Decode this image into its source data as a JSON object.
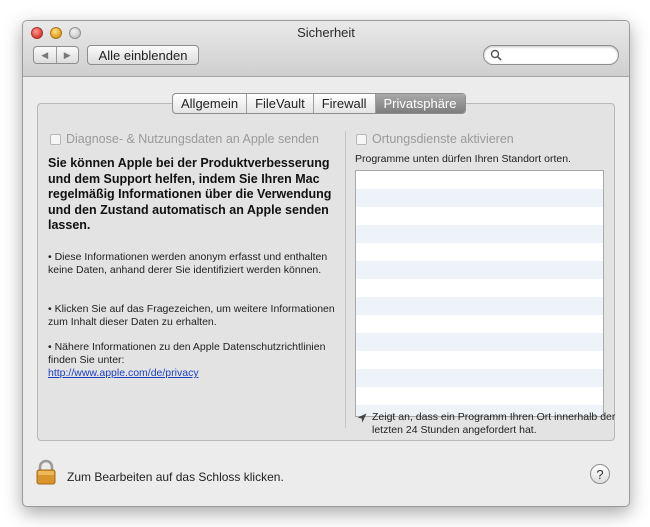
{
  "window": {
    "title": "Sicherheit"
  },
  "toolbar": {
    "back_glyph": "◀",
    "forward_glyph": "▶",
    "show_all_label": "Alle einblenden",
    "search_placeholder": "",
    "search_value": ""
  },
  "tabs": [
    {
      "label": "Allgemein",
      "active": false
    },
    {
      "label": "FileVault",
      "active": false
    },
    {
      "label": "Firewall",
      "active": false
    },
    {
      "label": "Privatsphäre",
      "active": true
    }
  ],
  "privacy": {
    "diagnostics_checkbox": {
      "label": "Diagnose- & Nutzungsdaten an Apple senden",
      "checked": false,
      "enabled": false
    },
    "intro_bold": "Sie können Apple bei der Produktverbesserung und dem Support helfen, indem Sie Ihren Mac regelmäßig Informationen über die Verwendung und den Zustand automatisch an Apple senden lassen.",
    "bullet_1": "• Diese Informationen werden anonym erfasst und enthalten keine Daten, anhand derer Sie identifiziert werden können.",
    "bullet_2": "• Klicken Sie auf das Fragezeichen, um weitere Informationen zum Inhalt dieser Daten zu erhalten.",
    "bullet_3": "• Nähere Informationen zu den Apple Datenschutzrichtlinien finden Sie unter:",
    "privacy_link": "http://www.apple.com/de/privacy",
    "location_checkbox": {
      "label": "Ortungsdienste aktivieren",
      "checked": false,
      "enabled": false
    },
    "location_list_label": "Programme unten dürfen Ihren Standort orten.",
    "location_note": "Zeigt an, dass ein Programm Ihren Ort innerhalb der letzten 24 Stunden angefordert hat."
  },
  "footer": {
    "lock_text": "Zum Bearbeiten auf das Schloss klicken.",
    "help_label": "?"
  },
  "colors": {
    "active_tab": "#8a8a8a",
    "link": "#1a3fc0",
    "list_stripe": "#eef2f9",
    "lock_gold": "#d9952c"
  }
}
